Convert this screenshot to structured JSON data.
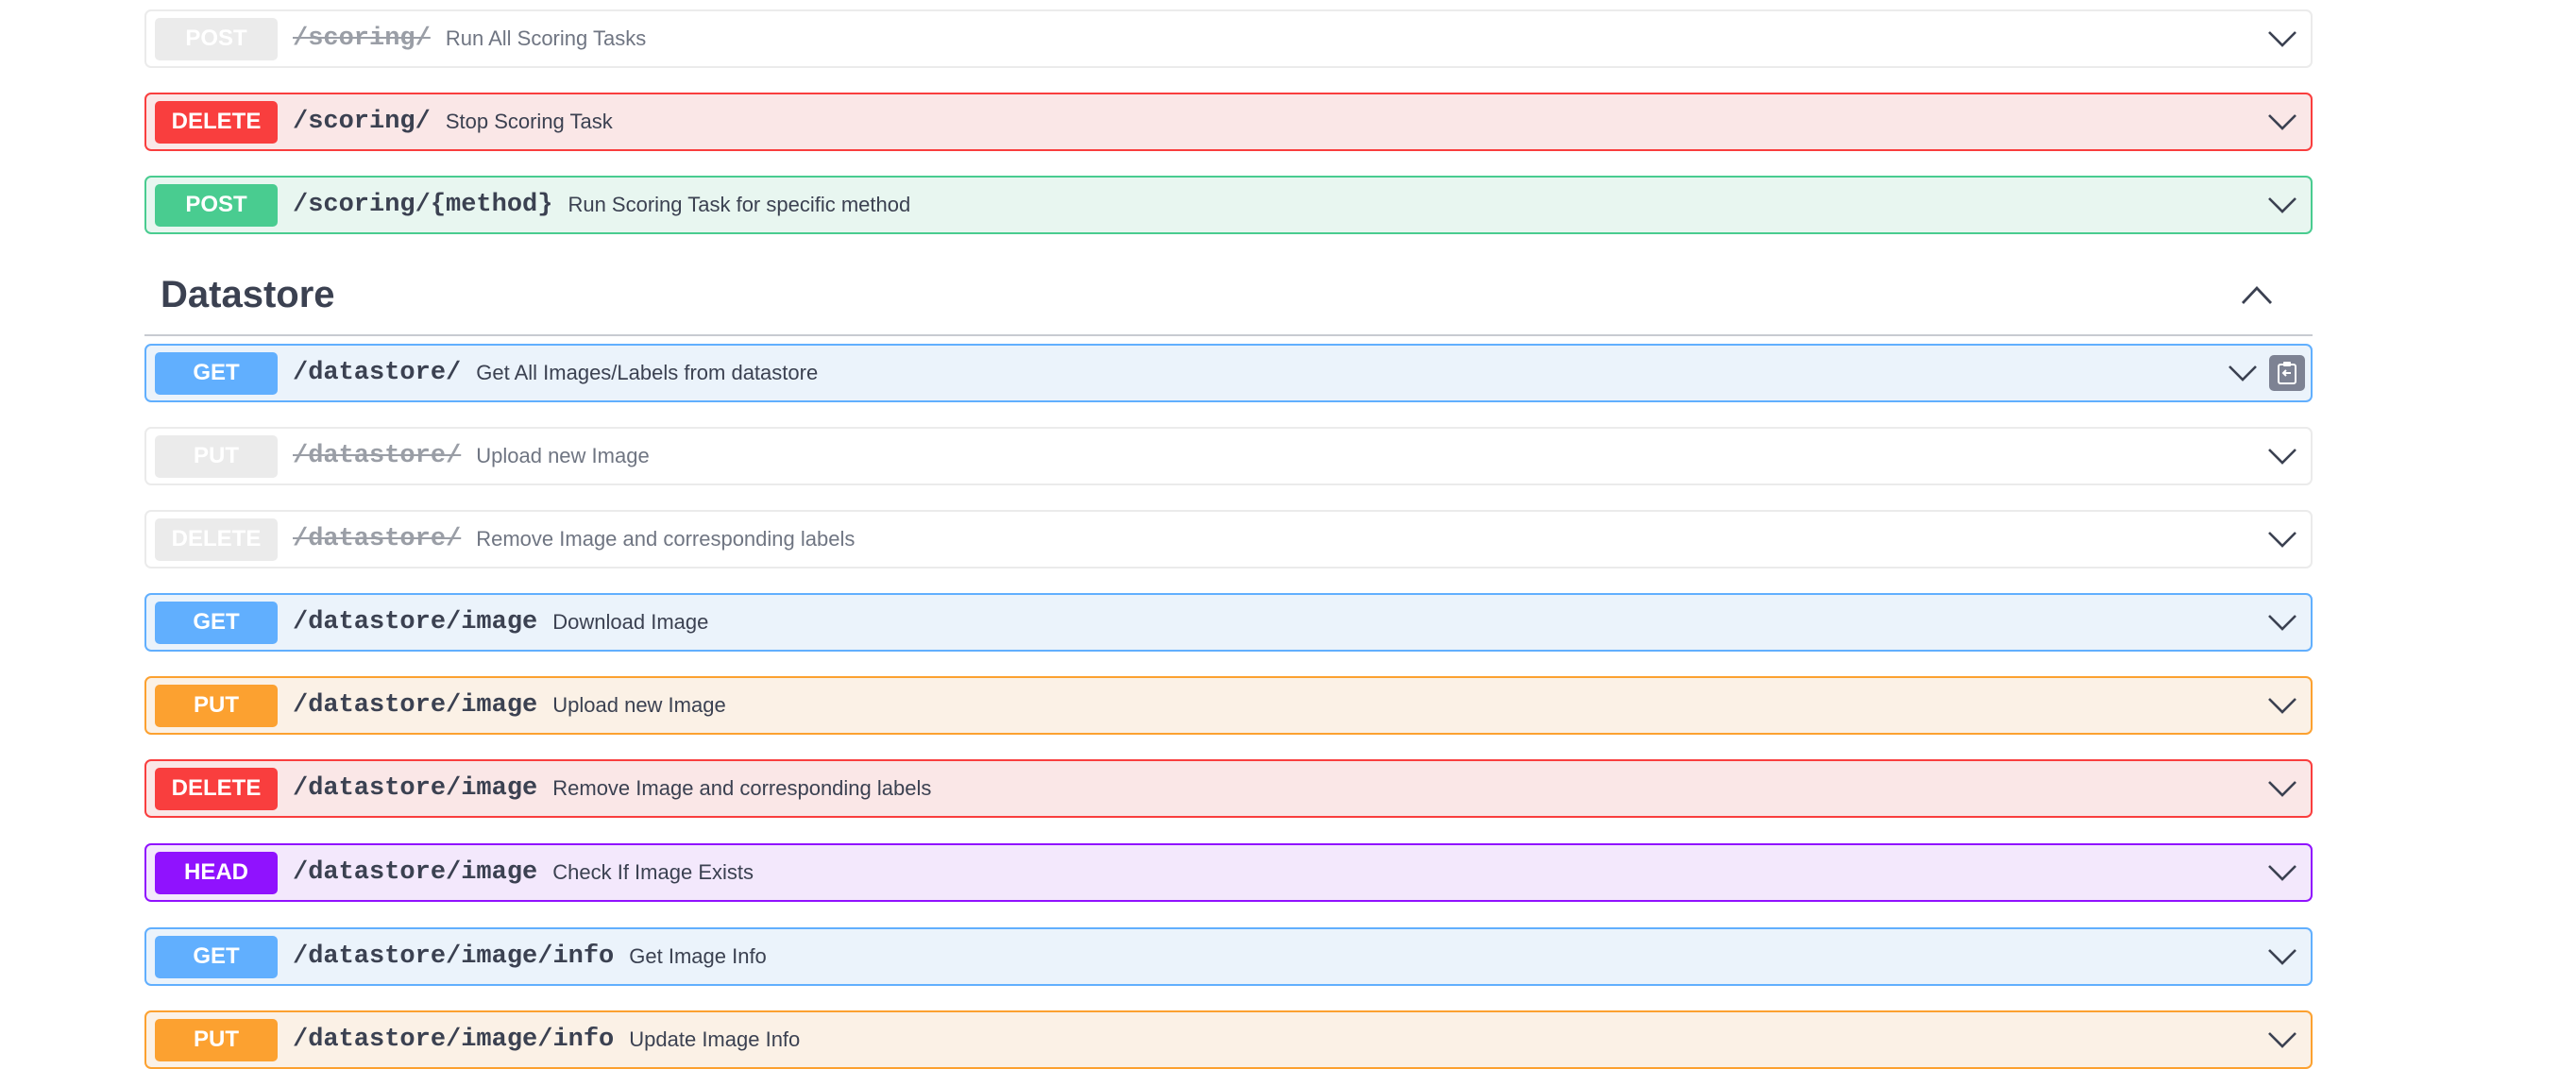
{
  "operations_top": [
    {
      "method": "POST",
      "path": "/scoring/",
      "summary": "Run All Scoring Tasks",
      "deprecated": true
    },
    {
      "method": "DELETE",
      "path": "/scoring/",
      "summary": "Stop Scoring Task",
      "deprecated": false
    },
    {
      "method": "POST",
      "path": "/scoring/{method}",
      "summary": "Run Scoring Task for specific method",
      "deprecated": false
    }
  ],
  "datastore": {
    "title": "Datastore",
    "operations": [
      {
        "method": "GET",
        "path": "/datastore/",
        "summary": "Get All Images/Labels from datastore",
        "deprecated": false
      },
      {
        "method": "PUT",
        "path": "/datastore/",
        "summary": "Upload new Image",
        "deprecated": true
      },
      {
        "method": "DELETE",
        "path": "/datastore/",
        "summary": "Remove Image and corresponding labels",
        "deprecated": true
      },
      {
        "method": "GET",
        "path": "/datastore/image",
        "summary": "Download Image",
        "deprecated": false
      },
      {
        "method": "PUT",
        "path": "/datastore/image",
        "summary": "Upload new Image",
        "deprecated": false
      },
      {
        "method": "DELETE",
        "path": "/datastore/image",
        "summary": "Remove Image and corresponding labels",
        "deprecated": false
      },
      {
        "method": "HEAD",
        "path": "/datastore/image",
        "summary": "Check If Image Exists",
        "deprecated": false
      },
      {
        "method": "GET",
        "path": "/datastore/image/info",
        "summary": "Get Image Info",
        "deprecated": false
      },
      {
        "method": "PUT",
        "path": "/datastore/image/info",
        "summary": "Update Image Info",
        "deprecated": false
      }
    ]
  },
  "colors": {
    "get": "#61affe",
    "post": "#49cc90",
    "put": "#fca130",
    "delete": "#f93e3e",
    "head": "#9012fe",
    "deprecated": "#ebebeb"
  }
}
